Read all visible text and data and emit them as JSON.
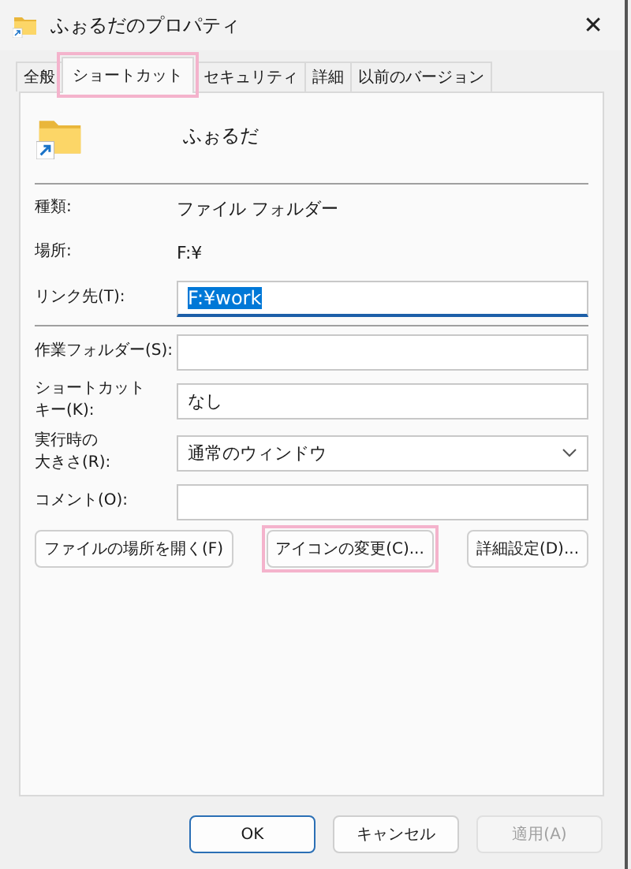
{
  "window": {
    "title": "ふぉるだのプロパティ",
    "close": "✕"
  },
  "tabs": [
    {
      "label": "全般",
      "selected": false,
      "highlighted": false
    },
    {
      "label": "ショートカット",
      "selected": true,
      "highlighted": true
    },
    {
      "label": "セキュリティ",
      "selected": false,
      "highlighted": false
    },
    {
      "label": "詳細",
      "selected": false,
      "highlighted": false
    },
    {
      "label": "以前のバージョン",
      "selected": false,
      "highlighted": false
    }
  ],
  "header": {
    "name": "ふぉるだ"
  },
  "info": [
    {
      "label": "種類:",
      "value": "ファイル フォルダー"
    },
    {
      "label": "場所:",
      "value": "F:¥"
    }
  ],
  "target": {
    "label": "リンク先(T):",
    "value": "F:¥work",
    "text_selected": true,
    "focused": true
  },
  "fields": [
    {
      "kind": "text",
      "label": [
        "作業フォルダー(S):"
      ]
    },
    {
      "kind": "text",
      "label": [
        "ショートカット",
        "キー(K):"
      ],
      "value": "なし"
    },
    {
      "kind": "select",
      "label": [
        "実行時の",
        "大きさ(R):"
      ],
      "value": "通常のウィンドウ"
    },
    {
      "kind": "text",
      "label": [
        "コメント(O):"
      ]
    }
  ],
  "actions": [
    {
      "label": "ファイルの場所を開く(F)",
      "highlighted": false
    },
    {
      "label": "アイコンの変更(C)...",
      "highlighted": true
    },
    {
      "label": "詳細設定(D)...",
      "highlighted": false
    }
  ],
  "buttons": [
    {
      "label": "OK",
      "default": true,
      "disabled": false
    },
    {
      "label": "キャンセル",
      "default": false,
      "disabled": false
    },
    {
      "label": "適用(A)",
      "default": false,
      "disabled": true
    }
  ]
}
